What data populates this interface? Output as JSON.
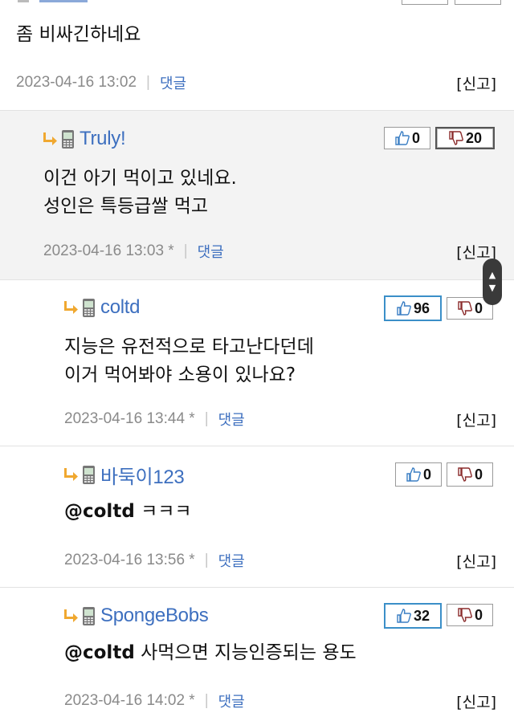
{
  "top_comment": {
    "text": "좀 비싸긴하네요",
    "date": "2023-04-16 13:02",
    "reply_label": "댓글",
    "report_label": "[신고]"
  },
  "replies": [
    {
      "author": "Truly!",
      "up": "0",
      "down": "20",
      "lines": [
        "이건 아기 먹이고 있네요.",
        "성인은 특등급쌀 먹고"
      ],
      "date": "2023-04-16 13:03 *",
      "reply_label": "댓글",
      "report_label": "[신고]"
    },
    {
      "author": "coltd",
      "up": "96",
      "down": "0",
      "lines": [
        "지능은 유전적으로 타고난다던데",
        "이거 먹어봐야 소용이 있나요?"
      ],
      "date": "2023-04-16 13:44 *",
      "reply_label": "댓글",
      "report_label": "[신고]"
    },
    {
      "author": "바둑이123",
      "up": "0",
      "down": "0",
      "mention": "@coltd",
      "text": " ㅋㅋㅋ",
      "date": "2023-04-16 13:56 *",
      "reply_label": "댓글",
      "report_label": "[신고]"
    },
    {
      "author": "SpongeBobs",
      "up": "32",
      "down": "0",
      "mention": "@coltd",
      "text": " 사먹으면 지능인증되는 용도",
      "date": "2023-04-16 14:02 *",
      "reply_label": "댓글",
      "report_label": "[신고]"
    }
  ],
  "colors": {
    "author": "#3d6fbf",
    "selected_up_border": "#3b8fc8",
    "arrow": "#f0a830"
  },
  "icons": [
    "reply-arrow-icon",
    "phone-icon",
    "thumbs-up-icon",
    "thumbs-down-icon",
    "scroll-up-icon",
    "scroll-down-icon"
  ]
}
